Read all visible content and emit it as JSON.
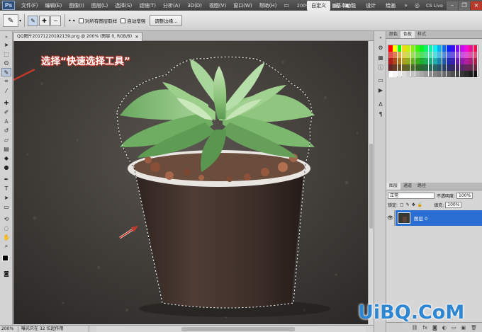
{
  "menubar": {
    "logo": "Ps",
    "items": [
      "文件(F)",
      "编辑(E)",
      "图像(I)",
      "图层(L)",
      "选择(S)",
      "滤镜(T)",
      "分析(A)",
      "3D(D)",
      "视图(V)",
      "窗口(W)",
      "帮助(H)"
    ],
    "zoom": "200%",
    "workspaces": [
      "自定义",
      "基本功能",
      "设计",
      "绘画"
    ],
    "active_workspace": "自定义",
    "extend_icon": "»",
    "cs_live": "CS Live"
  },
  "options_bar": {
    "sample_all_layers": "对所有图层取样",
    "auto_enhance": "自动增强",
    "refine_edge": "调整边缘..."
  },
  "document": {
    "tab_title": "QQ图片20171220192139.png @ 200% (图层 0, RGB/8)",
    "close": "×"
  },
  "annotation": {
    "label": "选择“快速选择工具”",
    "color": "#c0392b"
  },
  "status_bar": {
    "zoom": "200%",
    "info": "曝光只在 32 位起作用"
  },
  "swatches_panel": {
    "tabs": [
      "颜色",
      "色板",
      "样式"
    ],
    "active_tab": "色板"
  },
  "layers_panel": {
    "tabs": [
      "图层",
      "通道",
      "路径"
    ],
    "active_tab": "图层",
    "blend_mode": "正常",
    "opacity_label": "不透明度:",
    "opacity": "100%",
    "lock_label": "锁定:",
    "fill_label": "填充:",
    "fill": "100%",
    "layers": [
      {
        "name": "图层 0",
        "visible": true,
        "selected": true
      }
    ]
  },
  "watermark": "UiBQ.CoM"
}
